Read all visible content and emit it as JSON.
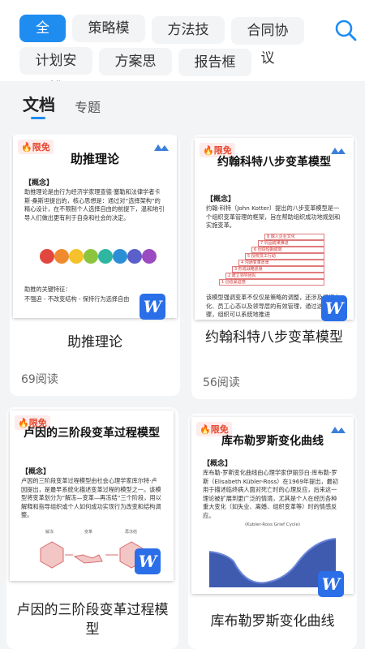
{
  "categories": [
    "全部",
    "策略模型",
    "方法技巧",
    "合同协议",
    "计划安排",
    "方案思路",
    "报告框架"
  ],
  "active_category": "全部",
  "tabs": {
    "docs": "文档",
    "topics": "专题"
  },
  "colors": {
    "accent": "#1f8cf0",
    "word_badge": "#2a6ee8",
    "free_badge": "#e5462e"
  },
  "cards": [
    {
      "badge": "限免",
      "doc_title": "助推理论",
      "concept_heading": "【概念】",
      "concept_text": "助推理论是由行为经济学家理查德·塞勒和法律学者卡斯·桑斯坦提出的，核心思想是：通过对“选择架构”的精心设计，在不限制个人选择自由的前提下，温和地引导人们做出更有利于自身和社会的决定。",
      "key_text": "助推的关键特征：",
      "key_text2": "不强迫 - 不改变结构 - 保持行为选择自由",
      "title": "助推理论",
      "reads": "69阅读"
    },
    {
      "badge": "限免",
      "doc_title": "约翰科特八步变革模型",
      "concept_heading": "【概念】",
      "concept_text": "约翰·科特（John Kotter）提出的八步变革模型是一个组织变革管理的框架，旨在帮助组织成功地规划和实施变革。",
      "key_text": "该模型强调变革不仅仅是策略的调整，还涉及组织文化、员工心态以及领导层的有效管理，通过这八个步骤，组织可以系统地推进",
      "steps": [
        "1 创造紧迫感",
        "2 建立领导团队",
        "3 形成战略愿景",
        "4 沟通变革愿景",
        "5 授权员工行动",
        "6 创造短期成效",
        "7 巩固成果推进",
        "8 融入企业文化"
      ],
      "title": "约翰科特八步变革模型",
      "reads": "56阅读"
    },
    {
      "badge": "限免",
      "doc_title": "卢因的三阶段变革过程模型",
      "concept_heading": "【概念】",
      "concept_text": "卢因的三阶段变革过程模型由社会心理学家库尔特·卢因提出，是最早系统化描述变革过程的模型之一。该模型将变革划分为“解冻—变革—再冻结”三个阶段，用以解释和指导组织或个人如何成功实现行为改变和结构调整。",
      "labels": [
        "解冻",
        "变革",
        "再冻结"
      ],
      "title": "卢因的三阶段变革过程模型"
    },
    {
      "badge": "限免",
      "doc_title": "库布勒罗斯变化曲线",
      "concept_heading": "【概念】",
      "concept_text": "库布勒-罗斯变化曲线由心理学家伊丽莎白·库布勒-罗斯（Elisabeth Kübler-Ross）在1969年提出，最初用于描述临终病人面对死亡时的心理反应，后来这一理论被扩展到更广泛的情境，尤其是个人在经历各种重大变化（如失业、离婚、组织变革等）时的情感反应。",
      "curve_caption": "(Kubler-Ross Grief Cycle)",
      "title": "库布勒罗斯变化曲线"
    }
  ]
}
